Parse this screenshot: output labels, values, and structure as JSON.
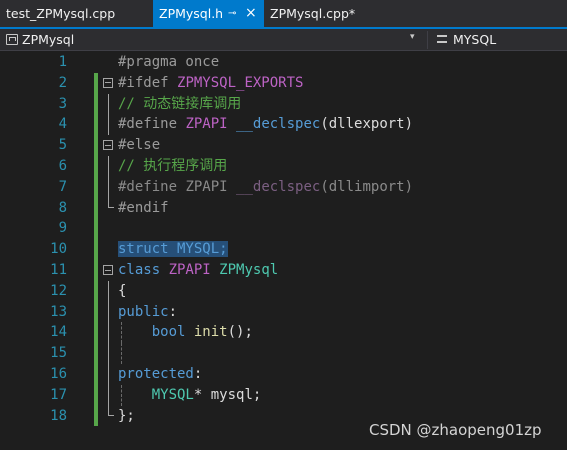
{
  "tabs": [
    {
      "label": "test_ZPMysql.cpp",
      "active": false
    },
    {
      "label": "ZPMysql.h",
      "active": true,
      "pin_icon": "⊸",
      "close_icon": "×"
    },
    {
      "label": "ZPMysql.cpp*",
      "active": false
    }
  ],
  "navbar": {
    "scope": "ZPMysql",
    "member": "MYSQL",
    "dropdown_glyph": "▾"
  },
  "colors": {
    "keyword": "#569cd6",
    "macro": "#bd63c5",
    "type": "#4ec9b0",
    "function": "#dcdcaa",
    "comment": "#57a64a",
    "line_number": "#2b91af",
    "selection": "#264f78",
    "accent": "#007acc"
  },
  "code_lines": [
    {
      "n": "1",
      "segs": [
        {
          "t": "#pragma once",
          "c": "grey"
        }
      ]
    },
    {
      "n": "2",
      "segs": [
        {
          "t": "#ifdef ",
          "c": "grey"
        },
        {
          "t": "ZPMYSQL_EXPORTS",
          "c": "mac"
        }
      ]
    },
    {
      "n": "3",
      "segs": [
        {
          "t": "// 动态链接库调用",
          "c": "com"
        }
      ]
    },
    {
      "n": "4",
      "segs": [
        {
          "t": "#define ",
          "c": "grey"
        },
        {
          "t": "ZPAPI",
          "c": "mac"
        },
        {
          "t": " ",
          "c": "plain"
        },
        {
          "t": "__declspec",
          "c": "kw"
        },
        {
          "t": "(dllexport)",
          "c": "plain"
        }
      ]
    },
    {
      "n": "5",
      "segs": [
        {
          "t": "#else",
          "c": "grey"
        }
      ]
    },
    {
      "n": "6",
      "segs": [
        {
          "t": "// 执行程序调用",
          "c": "com"
        }
      ]
    },
    {
      "n": "7",
      "segs": [
        {
          "t": "#define ",
          "c": "inact"
        },
        {
          "t": "ZPAPI",
          "c": "inact"
        },
        {
          "t": " ",
          "c": "inact"
        },
        {
          "t": "__declspec",
          "c": "inactmac"
        },
        {
          "t": "(dllimport)",
          "c": "inact"
        }
      ]
    },
    {
      "n": "8",
      "segs": [
        {
          "t": "#endif",
          "c": "grey"
        }
      ]
    },
    {
      "n": "9",
      "segs": []
    },
    {
      "n": "10",
      "segs": [
        {
          "t": "struct MYSQL;",
          "c": "kw",
          "sel": true
        }
      ]
    },
    {
      "n": "11",
      "segs": [
        {
          "t": "class ",
          "c": "kw"
        },
        {
          "t": "ZPAPI",
          "c": "mac"
        },
        {
          "t": " ",
          "c": "plain"
        },
        {
          "t": "ZPMysql",
          "c": "typ"
        }
      ]
    },
    {
      "n": "12",
      "segs": [
        {
          "t": "{",
          "c": "plain"
        }
      ]
    },
    {
      "n": "13",
      "segs": [
        {
          "t": "public",
          "c": "kw"
        },
        {
          "t": ":",
          "c": "plain"
        }
      ]
    },
    {
      "n": "14",
      "segs": [
        {
          "t": "    ",
          "c": "plain"
        },
        {
          "t": "bool",
          "c": "kw"
        },
        {
          "t": " ",
          "c": "plain"
        },
        {
          "t": "init",
          "c": "fn"
        },
        {
          "t": "();",
          "c": "plain"
        }
      ]
    },
    {
      "n": "15",
      "segs": []
    },
    {
      "n": "16",
      "segs": [
        {
          "t": "protected",
          "c": "kw"
        },
        {
          "t": ":",
          "c": "plain"
        }
      ]
    },
    {
      "n": "17",
      "segs": [
        {
          "t": "    ",
          "c": "plain"
        },
        {
          "t": "MYSQL",
          "c": "typ"
        },
        {
          "t": "* mysql;",
          "c": "plain"
        }
      ]
    },
    {
      "n": "18",
      "segs": [
        {
          "t": "};",
          "c": "plain"
        }
      ]
    }
  ],
  "watermark": "CSDN @zhaopeng01zp"
}
